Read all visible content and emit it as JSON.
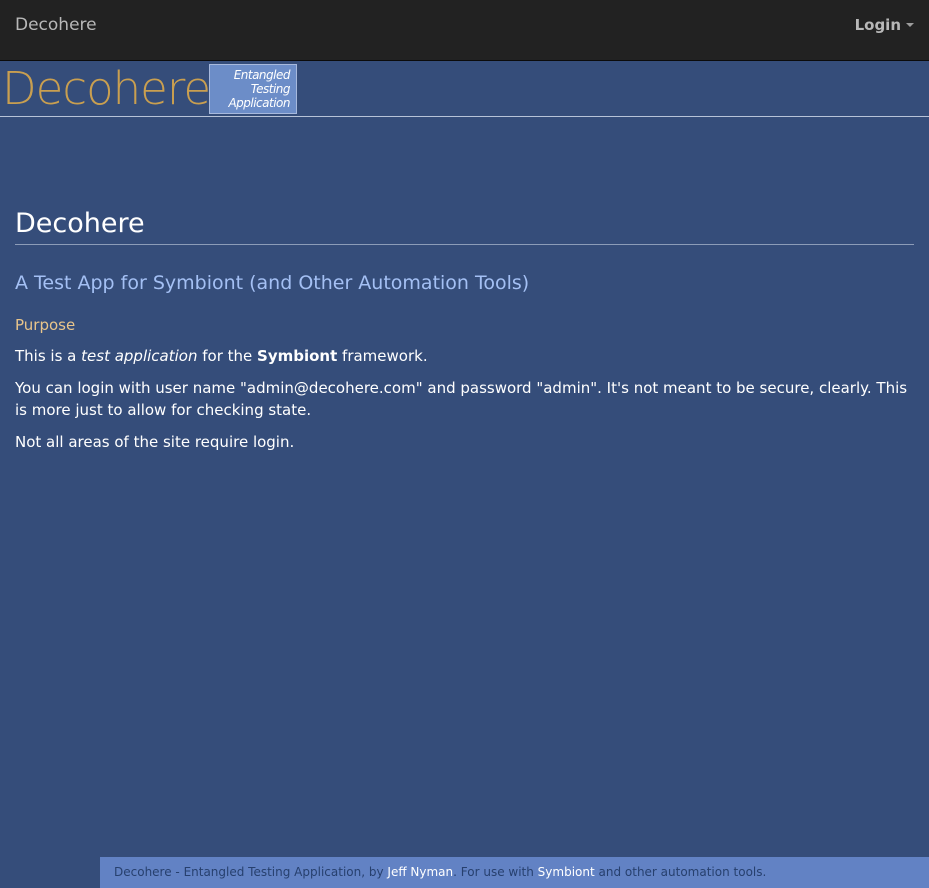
{
  "navbar": {
    "brand": "Decohere",
    "login_label": "Login"
  },
  "banner": {
    "logo_text": "Decohere",
    "badge_line1": "Entangled",
    "badge_line2": "Testing",
    "badge_line3": "Application"
  },
  "main": {
    "title": "Decohere",
    "subtitle": "A Test App for Symbiont (and Other Automation Tools)",
    "section_title": "Purpose",
    "para1_prefix": "This is a ",
    "para1_em": "test application",
    "para1_mid": " for the ",
    "para1_strong": "Symbiont",
    "para1_suffix": " framework.",
    "para2": "You can login with user name \"admin@decohere.com\" and password \"admin\". It's not meant to be secure, clearly. This is more just to allow for checking state.",
    "para3": "Not all areas of the site require login."
  },
  "footer": {
    "prefix": "Decohere - Entangled Testing Application, by ",
    "author_link": "Jeff Nyman",
    "middle": ". For use with ",
    "symbiont_link": "Symbiont",
    "suffix": " and other automation tools."
  }
}
